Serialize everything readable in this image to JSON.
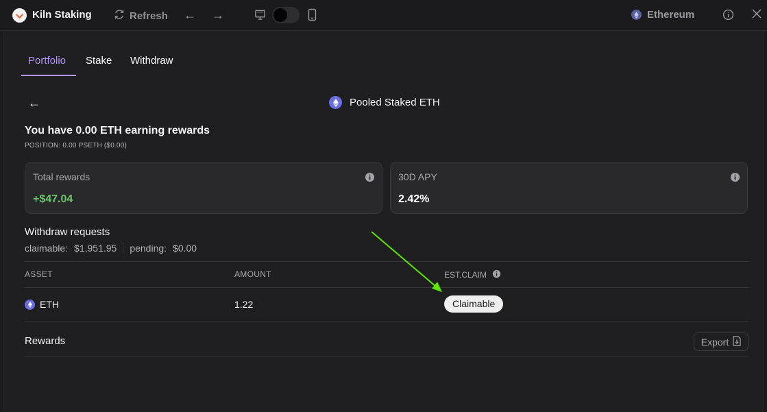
{
  "app": {
    "title": "Kiln Staking",
    "refresh_label": "Refresh",
    "network": "Ethereum"
  },
  "tabs": [
    {
      "label": "Portfolio",
      "active": true
    },
    {
      "label": "Stake",
      "active": false
    },
    {
      "label": "Withdraw",
      "active": false
    }
  ],
  "pool": {
    "title": "Pooled Staked ETH"
  },
  "summary": {
    "headline": "You have 0.00 ETH earning rewards",
    "position": "POSITION: 0.00 PSETH ($0.00)"
  },
  "cards": {
    "total_rewards": {
      "label": "Total rewards",
      "value": "+$47.04"
    },
    "apy": {
      "label": "30D APY",
      "value": "2.42%"
    }
  },
  "withdraw": {
    "title": "Withdraw requests",
    "claimable_label": "claimable:",
    "claimable_value": "$1,951.95",
    "pending_label": "pending:",
    "pending_value": "$0.00",
    "columns": {
      "asset": "ASSET",
      "amount": "AMOUNT",
      "est_claim": "EST.CLAIM"
    },
    "rows": [
      {
        "asset": "ETH",
        "amount": "1.22",
        "status": "Claimable"
      }
    ]
  },
  "rewards": {
    "title": "Rewards",
    "export_label": "Export"
  },
  "colors": {
    "accent": "#b497f5",
    "positive": "#6bc36a",
    "annotation_arrow": "#5ce600",
    "eth": "#6a6fe0"
  }
}
